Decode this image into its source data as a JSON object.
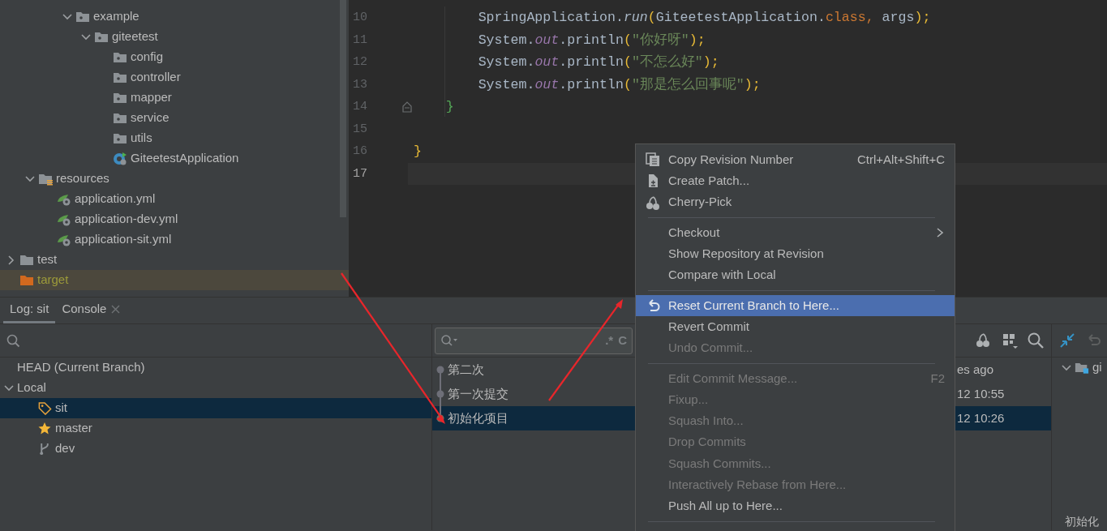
{
  "project_tree": [
    {
      "children": [
        {
          "children": [
            {
              "children": [
                {
                  "label": "example",
                  "kind": "package",
                  "expanded": true,
                  "children": [
                    {
                      "label": "giteetest",
                      "kind": "package",
                      "expanded": true,
                      "children": [
                        {
                          "label": "config",
                          "kind": "package"
                        },
                        {
                          "label": "controller",
                          "kind": "package"
                        },
                        {
                          "label": "mapper",
                          "kind": "package"
                        },
                        {
                          "label": "service",
                          "kind": "package"
                        },
                        {
                          "label": "utils",
                          "kind": "package"
                        },
                        {
                          "label": "GiteetestApplication",
                          "kind": "java-class"
                        }
                      ]
                    }
                  ]
                }
              ]
            }
          ]
        },
        {
          "label": "resources",
          "kind": "resources-folder",
          "expanded": true,
          "children": [
            {
              "label": "application.yml",
              "kind": "config-file"
            },
            {
              "label": "application-dev.yml",
              "kind": "config-file"
            },
            {
              "label": "application-sit.yml",
              "kind": "config-file"
            }
          ]
        }
      ]
    },
    {
      "label": "test",
      "kind": "folder",
      "expanded": false
    },
    {
      "label": "target",
      "kind": "excluded-folder"
    }
  ],
  "editor": {
    "lines": [
      {
        "number": "10",
        "current": false,
        "fold": false,
        "tokens": [
          {
            "text": "        SpringApplication.",
            "kind": "plain"
          },
          {
            "text": "run",
            "kind": "method-static"
          },
          {
            "text": "(",
            "kind": "paren"
          },
          {
            "text": "GiteetestApplication.",
            "kind": "plain"
          },
          {
            "text": "class",
            "kind": "keyword"
          },
          {
            "text": ", ",
            "kind": "keyword"
          },
          {
            "text": "args",
            "kind": "plain"
          },
          {
            "text": ");",
            "kind": "paren"
          }
        ]
      },
      {
        "number": "11",
        "current": false,
        "fold": false,
        "tokens": [
          {
            "text": "        System.",
            "kind": "plain"
          },
          {
            "text": "out",
            "kind": "field-static"
          },
          {
            "text": ".println",
            "kind": "plain"
          },
          {
            "text": "(",
            "kind": "paren"
          },
          {
            "text": "\"你好呀\"",
            "kind": "string"
          },
          {
            "text": ");",
            "kind": "paren"
          }
        ]
      },
      {
        "number": "12",
        "current": false,
        "fold": false,
        "tokens": [
          {
            "text": "        System.",
            "kind": "plain"
          },
          {
            "text": "out",
            "kind": "field-static"
          },
          {
            "text": ".println",
            "kind": "plain"
          },
          {
            "text": "(",
            "kind": "paren"
          },
          {
            "text": "\"不怎么好\"",
            "kind": "string"
          },
          {
            "text": ");",
            "kind": "paren"
          }
        ]
      },
      {
        "number": "13",
        "current": false,
        "fold": false,
        "tokens": [
          {
            "text": "        System.",
            "kind": "plain"
          },
          {
            "text": "out",
            "kind": "field-static"
          },
          {
            "text": ".println",
            "kind": "plain"
          },
          {
            "text": "(",
            "kind": "paren"
          },
          {
            "text": "\"那是怎么回事呢\"",
            "kind": "string"
          },
          {
            "text": ");",
            "kind": "paren"
          }
        ]
      },
      {
        "number": "14",
        "current": false,
        "fold": true,
        "tokens": [
          {
            "text": "    }",
            "kind": "brace-inner"
          }
        ]
      },
      {
        "number": "15",
        "current": false,
        "fold": false
      },
      {
        "number": "16",
        "current": false,
        "fold": false,
        "tokens": [
          {
            "text": "}",
            "kind": "brace-outer"
          }
        ]
      },
      {
        "number": "17",
        "current": true,
        "fold": false
      }
    ]
  },
  "bottom_tabs": [
    {
      "label": "Log: sit",
      "selected": true,
      "closable": false
    },
    {
      "label": "Console",
      "selected": false,
      "closable": true
    }
  ],
  "branches": [
    {
      "label": "HEAD (Current Branch)"
    },
    {
      "label": "Local",
      "expanded": true,
      "children": [
        {
          "label": "sit",
          "kind": "tag",
          "selected": true
        },
        {
          "label": "master",
          "kind": "star",
          "selected": false
        },
        {
          "label": "dev",
          "kind": "branch",
          "selected": false
        }
      ]
    }
  ],
  "commit_search": {
    "regex_toggle": ".*",
    "case_toggle": "C"
  },
  "commits": [
    {
      "message": "第二次",
      "date": "es ago",
      "selected": false
    },
    {
      "message": "第一次提交",
      "date": "12 10:55",
      "selected": false
    },
    {
      "message": "初始化项目",
      "date": "12 10:26",
      "selected": true
    }
  ],
  "changes_pane": {
    "root_label": "gi",
    "footer_text": "初始化"
  },
  "context_menu": [
    {
      "kind": "copy",
      "label": "Copy Revision Number",
      "shortcut": "Ctrl+Alt+Shift+C",
      "disabled": false,
      "selected": false
    },
    {
      "kind": "patch",
      "label": "Create Patch...",
      "disabled": false,
      "selected": false
    },
    {
      "kind": "cherry",
      "label": "Cherry-Pick",
      "disabled": false,
      "selected": false
    },
    {
      "kind": "separator"
    },
    {
      "kind": "submenu",
      "label": "Checkout",
      "disabled": false,
      "selected": false
    },
    {
      "kind": "item",
      "label": "Show Repository at Revision",
      "disabled": false,
      "selected": false
    },
    {
      "kind": "item",
      "label": "Compare with Local",
      "disabled": false,
      "selected": false
    },
    {
      "kind": "separator"
    },
    {
      "kind": "reset",
      "label": "Reset Current Branch to Here...",
      "disabled": false,
      "selected": true
    },
    {
      "kind": "item",
      "label": "Revert Commit",
      "disabled": false,
      "selected": false
    },
    {
      "kind": "item",
      "label": "Undo Commit...",
      "disabled": true,
      "selected": false
    },
    {
      "kind": "separator"
    },
    {
      "kind": "item",
      "label": "Edit Commit Message...",
      "shortcut": "F2",
      "disabled": true,
      "selected": false
    },
    {
      "kind": "item",
      "label": "Fixup...",
      "disabled": true,
      "selected": false
    },
    {
      "kind": "item",
      "label": "Squash Into...",
      "disabled": true,
      "selected": false
    },
    {
      "kind": "item",
      "label": "Drop Commits",
      "disabled": true,
      "selected": false
    },
    {
      "kind": "item",
      "label": "Squash Commits...",
      "disabled": true,
      "selected": false
    },
    {
      "kind": "item",
      "label": "Interactively Rebase from Here...",
      "disabled": true,
      "selected": false
    },
    {
      "kind": "item",
      "label": "Push All up to Here...",
      "disabled": false,
      "selected": false
    },
    {
      "kind": "separator"
    }
  ]
}
